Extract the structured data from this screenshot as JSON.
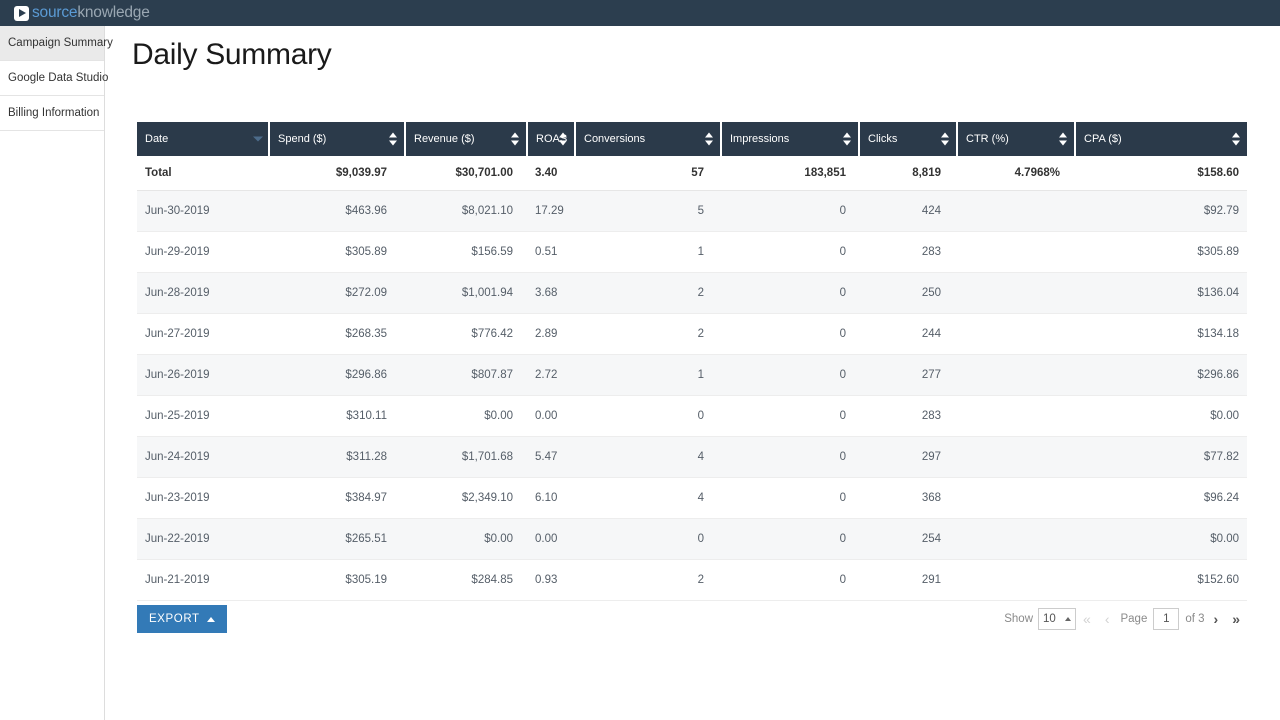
{
  "brand": {
    "icon": "play-icon",
    "name_part1": "source",
    "name_part2": "knowledge",
    "bar_color": "#2c3e4f",
    "accent_color": "#5b9bd5"
  },
  "sidebar": {
    "items": [
      {
        "label": "Campaign Summary",
        "active": true
      },
      {
        "label": "Google Data Studio",
        "active": false
      },
      {
        "label": "Billing Information",
        "active": false
      }
    ]
  },
  "main": {
    "title": "Daily Summary"
  },
  "table": {
    "columns": [
      {
        "label": "Date",
        "sort": "desc",
        "align": "left",
        "key": "date"
      },
      {
        "label": "Spend ($)",
        "sort": "both",
        "align": "right",
        "key": "spend"
      },
      {
        "label": "Revenue ($)",
        "sort": "both",
        "align": "right",
        "key": "revenue"
      },
      {
        "label": "ROAS",
        "sort": "both",
        "align": "right",
        "key": "roas"
      },
      {
        "label": "Conversions",
        "sort": "both",
        "align": "right",
        "key": "conversions"
      },
      {
        "label": "Impressions",
        "sort": "both",
        "align": "right",
        "key": "impressions"
      },
      {
        "label": "Clicks",
        "sort": "both",
        "align": "right",
        "key": "clicks"
      },
      {
        "label": "CTR (%)",
        "sort": "both",
        "align": "right",
        "key": "ctr"
      },
      {
        "label": "CPA ($)",
        "sort": "both",
        "align": "right",
        "key": "cpa"
      }
    ],
    "total_row": {
      "date": "Total",
      "spend": "$9,039.97",
      "revenue": "$30,701.00",
      "roas": "3.40",
      "conversions": "57",
      "impressions": "183,851",
      "clicks": "8,819",
      "ctr": "4.7968%",
      "cpa": "$158.60"
    },
    "rows": [
      {
        "date": "Jun-30-2019",
        "spend": "$463.96",
        "revenue": "$8,021.10",
        "roas": "17.29",
        "conversions": "5",
        "impressions": "0",
        "clicks": "424",
        "ctr": "",
        "cpa": "$92.79"
      },
      {
        "date": "Jun-29-2019",
        "spend": "$305.89",
        "revenue": "$156.59",
        "roas": "0.51",
        "conversions": "1",
        "impressions": "0",
        "clicks": "283",
        "ctr": "",
        "cpa": "$305.89"
      },
      {
        "date": "Jun-28-2019",
        "spend": "$272.09",
        "revenue": "$1,001.94",
        "roas": "3.68",
        "conversions": "2",
        "impressions": "0",
        "clicks": "250",
        "ctr": "",
        "cpa": "$136.04"
      },
      {
        "date": "Jun-27-2019",
        "spend": "$268.35",
        "revenue": "$776.42",
        "roas": "2.89",
        "conversions": "2",
        "impressions": "0",
        "clicks": "244",
        "ctr": "",
        "cpa": "$134.18"
      },
      {
        "date": "Jun-26-2019",
        "spend": "$296.86",
        "revenue": "$807.87",
        "roas": "2.72",
        "conversions": "1",
        "impressions": "0",
        "clicks": "277",
        "ctr": "",
        "cpa": "$296.86"
      },
      {
        "date": "Jun-25-2019",
        "spend": "$310.11",
        "revenue": "$0.00",
        "roas": "0.00",
        "conversions": "0",
        "impressions": "0",
        "clicks": "283",
        "ctr": "",
        "cpa": "$0.00"
      },
      {
        "date": "Jun-24-2019",
        "spend": "$311.28",
        "revenue": "$1,701.68",
        "roas": "5.47",
        "conversions": "4",
        "impressions": "0",
        "clicks": "297",
        "ctr": "",
        "cpa": "$77.82"
      },
      {
        "date": "Jun-23-2019",
        "spend": "$384.97",
        "revenue": "$2,349.10",
        "roas": "6.10",
        "conversions": "4",
        "impressions": "0",
        "clicks": "368",
        "ctr": "",
        "cpa": "$96.24"
      },
      {
        "date": "Jun-22-2019",
        "spend": "$265.51",
        "revenue": "$0.00",
        "roas": "0.00",
        "conversions": "0",
        "impressions": "0",
        "clicks": "254",
        "ctr": "",
        "cpa": "$0.00"
      },
      {
        "date": "Jun-21-2019",
        "spend": "$305.19",
        "revenue": "$284.85",
        "roas": "0.93",
        "conversions": "2",
        "impressions": "0",
        "clicks": "291",
        "ctr": "",
        "cpa": "$152.60"
      }
    ]
  },
  "footer": {
    "export_label": "EXPORT",
    "export_caret": "caret-up-icon",
    "show_label": "Show",
    "page_size": "10",
    "first_icon": "«",
    "prev_icon": "‹",
    "page_label": "Page",
    "page_value": "1",
    "of_label": "of 3",
    "next_icon": "›",
    "last_icon": "»",
    "button_color": "#337ab7"
  }
}
